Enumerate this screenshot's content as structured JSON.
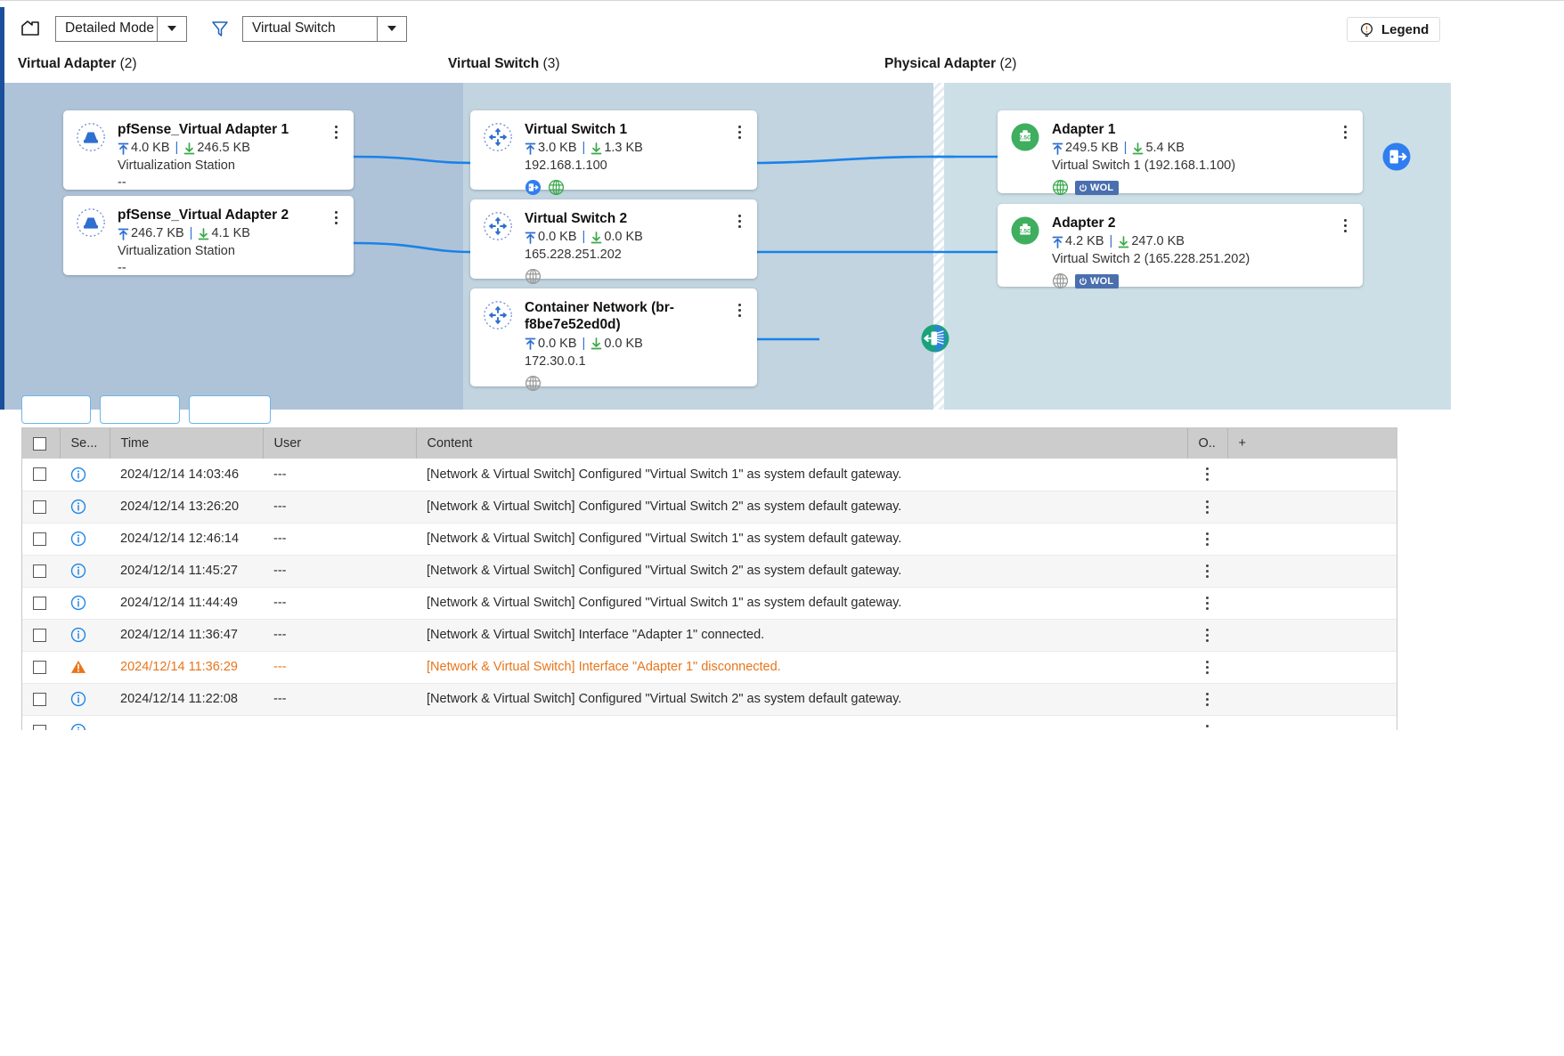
{
  "toolbar": {
    "home_icon": "home-icon",
    "mode_select": {
      "value": "Detailed Mode",
      "icon": "chevron-down-icon"
    },
    "filter_icon": "filter-funnel-icon",
    "filter_select": {
      "value": "Virtual Switch",
      "icon": "chevron-down-icon"
    },
    "legend_button": {
      "label": "Legend",
      "icon": "info-bulb-icon"
    }
  },
  "diagram": {
    "columns": [
      {
        "title": "Virtual Adapter",
        "count": "(2)"
      },
      {
        "title": "Virtual Switch",
        "count": "(3)"
      },
      {
        "title": "Physical Adapter",
        "count": "(2)"
      }
    ],
    "colors": {
      "band_virtual_adapter": "#aec3d8",
      "band_virtual_switch": "#c1d4e0",
      "band_physical_adapter": "#cddfe6",
      "link_line": "#1a82e8",
      "accent_blue": "#1b4f9c",
      "upload_arrow": "#2f6fd0",
      "download_arrow": "#3aa84a",
      "wol_badge": "#4a6fae",
      "adapter_icon_green": "#3fae5e",
      "warning_orange": "#e8751a",
      "info_blue": "#1a82e8"
    },
    "virtual_adapters": [
      {
        "name": "pfSense_Virtual Adapter 1",
        "upload": "4.0 KB",
        "download": "246.5 KB",
        "source": "Virtualization Station",
        "extra": "--",
        "icon": "virtual-adapter-icon"
      },
      {
        "name": "pfSense_Virtual Adapter 2",
        "upload": "246.7 KB",
        "download": "4.1 KB",
        "source": "Virtualization Station",
        "extra": "--",
        "icon": "virtual-adapter-icon"
      }
    ],
    "virtual_switches": [
      {
        "name": "Virtual Switch 1",
        "upload": "3.0 KB",
        "download": "1.3 KB",
        "address": "192.168.1.100",
        "icon": "virtual-switch-icon",
        "badges": [
          "gateway-icon",
          "globe-icon-green"
        ]
      },
      {
        "name": "Virtual Switch 2",
        "upload": "0.0 KB",
        "download": "0.0 KB",
        "address": "165.228.251.202",
        "icon": "virtual-switch-icon",
        "badges": [
          "globe-icon-gray"
        ]
      },
      {
        "name": "Container Network (br-f8be7e52ed0d)",
        "upload": "0.0 KB",
        "download": "0.0 KB",
        "address": "172.30.0.1",
        "icon": "virtual-switch-icon",
        "badges": [
          "globe-icon-gray"
        ]
      }
    ],
    "physical_adapters": [
      {
        "name": "Adapter 1",
        "speed": "2.5G",
        "upload": "249.5 KB",
        "download": "5.4 KB",
        "bound_to": "Virtual Switch 1 (192.168.1.100)",
        "icon": "physical-adapter-icon",
        "globe": "globe-icon-green",
        "wol_label": "WOL"
      },
      {
        "name": "Adapter 2",
        "speed": "2.5G",
        "upload": "4.2 KB",
        "download": "247.0 KB",
        "bound_to": "Virtual Switch 2 (165.228.251.202)",
        "icon": "physical-adapter-icon",
        "globe": "globe-icon-gray",
        "wol_label": "WOL"
      }
    ],
    "edge_icons": [
      {
        "name": "internet-gateway-icon",
        "color": "#2f7ef0"
      },
      {
        "name": "container-network-endpoint-icon",
        "color": "#1aa37a"
      }
    ]
  },
  "log_table": {
    "columns": [
      "",
      "Se...",
      "Time",
      "User",
      "Content",
      "O..",
      "+"
    ],
    "rows": [
      {
        "severity": "info",
        "time": "2024/12/14 14:03:46",
        "user": "---",
        "content": "[Network & Virtual Switch] Configured \"Virtual Switch 1\" as system default gateway."
      },
      {
        "severity": "info",
        "time": "2024/12/14 13:26:20",
        "user": "---",
        "content": "[Network & Virtual Switch] Configured \"Virtual Switch 2\" as system default gateway."
      },
      {
        "severity": "info",
        "time": "2024/12/14 12:46:14",
        "user": "---",
        "content": "[Network & Virtual Switch] Configured \"Virtual Switch 1\" as system default gateway."
      },
      {
        "severity": "info",
        "time": "2024/12/14 11:45:27",
        "user": "---",
        "content": "[Network & Virtual Switch] Configured \"Virtual Switch 2\" as system default gateway."
      },
      {
        "severity": "info",
        "time": "2024/12/14 11:44:49",
        "user": "---",
        "content": "[Network & Virtual Switch] Configured \"Virtual Switch 1\" as system default gateway."
      },
      {
        "severity": "info",
        "time": "2024/12/14 11:36:47",
        "user": "---",
        "content": "[Network & Virtual Switch] Interface \"Adapter 1\" connected."
      },
      {
        "severity": "warning",
        "time": "2024/12/14 11:36:29",
        "user": "---",
        "content": "[Network & Virtual Switch] Interface \"Adapter 1\" disconnected."
      },
      {
        "severity": "info",
        "time": "2024/12/14 11:22:08",
        "user": "---",
        "content": "[Network & Virtual Switch] Configured \"Virtual Switch 2\" as system default gateway."
      },
      {
        "severity": "info",
        "time": "",
        "user": "",
        "content": ""
      }
    ]
  }
}
